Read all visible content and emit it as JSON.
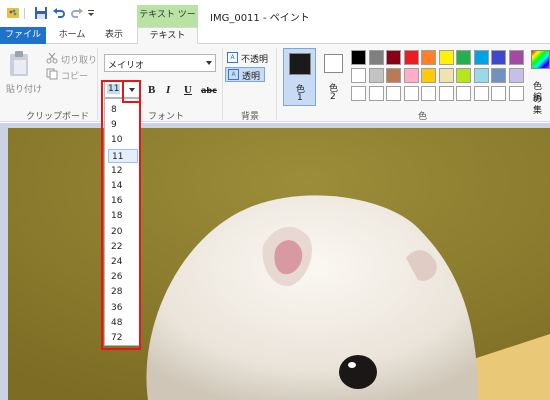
{
  "window": {
    "title": "IMG_0011 - ペイント",
    "context_tab": "テキスト ツール"
  },
  "tabs": {
    "file": "ファイル",
    "home": "ホーム",
    "view": "表示",
    "text": "テキスト"
  },
  "clipboard": {
    "paste": "貼り付け",
    "cut": "切り取り",
    "copy": "コピー",
    "label": "クリップボード"
  },
  "font": {
    "name": "メイリオ",
    "size": "11",
    "label": "フォント",
    "bold": "B",
    "italic": "I",
    "underline": "U",
    "strike": "abc"
  },
  "background": {
    "opaque": "不透明",
    "transparent": "透明",
    "label": "背景"
  },
  "colors": {
    "color1_label": "色",
    "color1_num": "1",
    "color2_label": "色",
    "color2_num": "2",
    "label": "色",
    "edit_label": "色の",
    "edit_label2": "編集",
    "color1": "#1b1a1b",
    "color2": "#ffffff"
  },
  "font_sizes": [
    "8",
    "9",
    "10",
    "11",
    "12",
    "14",
    "16",
    "18",
    "20",
    "22",
    "24",
    "26",
    "28",
    "36",
    "48",
    "72"
  ],
  "selected_size": "11",
  "accent": "#e8151e"
}
